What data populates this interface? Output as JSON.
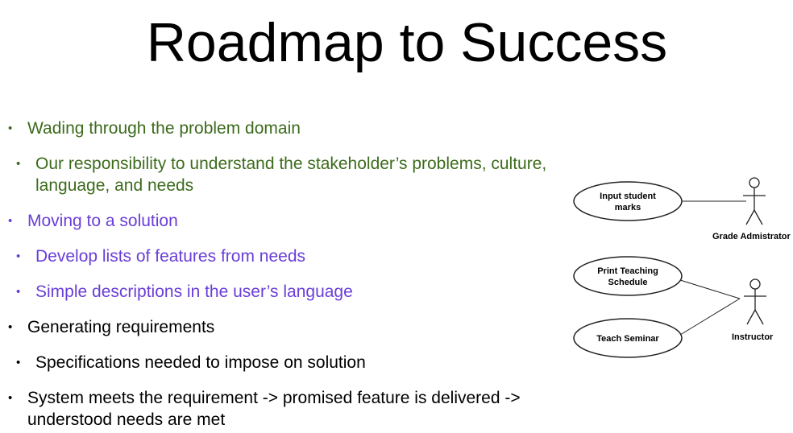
{
  "title": "Roadmap to Success",
  "bullets": [
    {
      "text": "Wading through the problem domain",
      "level": 1,
      "color": "#3c6b1c"
    },
    {
      "text": "Our responsibility to understand the stakeholder’s problems, culture, language, and needs",
      "level": 2,
      "color": "#3c6b1c"
    },
    {
      "text": "Moving to a solution",
      "level": 1,
      "color": "#6a3ed8"
    },
    {
      "text": "Develop lists of features from needs",
      "level": 2,
      "color": "#6a3ed8"
    },
    {
      "text": "Simple descriptions in the user’s language",
      "level": 2,
      "color": "#6a3ed8"
    },
    {
      "text": "Generating requirements",
      "level": 1,
      "color": "#000000"
    },
    {
      "text": "Specifications needed to impose on solution",
      "level": 2,
      "color": "#000000"
    },
    {
      "text": "System meets the requirement -> promised feature is delivered -> understood needs are met",
      "level": 1,
      "color": "#000000"
    }
  ],
  "diagram": {
    "use_cases": [
      {
        "line1": "Input student",
        "line2": "marks"
      },
      {
        "line1": "Print Teaching",
        "line2": "Schedule"
      },
      {
        "line1": "Teach Seminar",
        "line2": ""
      }
    ],
    "actors": [
      {
        "label": "Grade Admistrator"
      },
      {
        "label": "Instructor"
      }
    ]
  }
}
